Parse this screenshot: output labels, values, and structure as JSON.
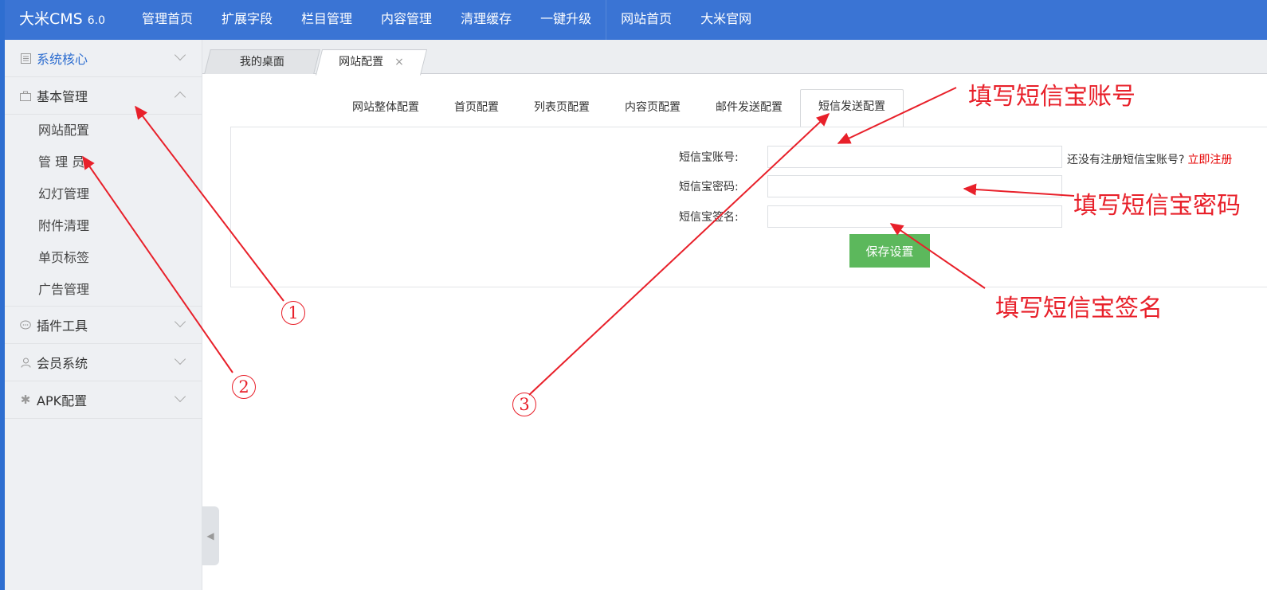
{
  "header": {
    "brand": "大米CMS",
    "version": "6.0",
    "nav": [
      "管理首页",
      "扩展字段",
      "栏目管理",
      "内容管理",
      "清理缓存",
      "一键升级",
      "网站首页",
      "大米官网"
    ]
  },
  "sidebar": {
    "groups": [
      {
        "label": "系统核心",
        "icon": "grid-icon"
      },
      {
        "label": "基本管理",
        "icon": "briefcase-icon"
      },
      {
        "label": "插件工具",
        "icon": "chat-icon"
      },
      {
        "label": "会员系统",
        "icon": "user-icon"
      },
      {
        "label": "APK配置",
        "icon": "gear-icon"
      }
    ],
    "subitems": [
      "网站配置",
      "管 理 员",
      "幻灯管理",
      "附件清理",
      "单页标签",
      "广告管理"
    ]
  },
  "content_tabs": {
    "desktop": "我的桌面",
    "site_config": "网站配置",
    "close": "×"
  },
  "config_tabs": [
    "网站整体配置",
    "首页配置",
    "列表页配置",
    "内容页配置",
    "邮件发送配置",
    "短信发送配置"
  ],
  "form": {
    "account_label": "短信宝账号:",
    "password_label": "短信宝密码:",
    "signature_label": "短信宝签名:",
    "account_value": "",
    "password_value": "",
    "signature_value": "",
    "hint_text": "还没有注册短信宝账号?",
    "hint_link": "立即注册",
    "save_label": "保存设置"
  },
  "annotations": {
    "fill_account": "填写短信宝账号",
    "fill_password": "填写短信宝密码",
    "fill_signature": "填写短信宝签名",
    "step1": "1",
    "step2": "2",
    "step3": "3",
    "color": "#e8202a"
  },
  "colors": {
    "topbar": "#3a74d4",
    "save_button": "#5cb85c",
    "active_link": "#2e6ed0"
  }
}
